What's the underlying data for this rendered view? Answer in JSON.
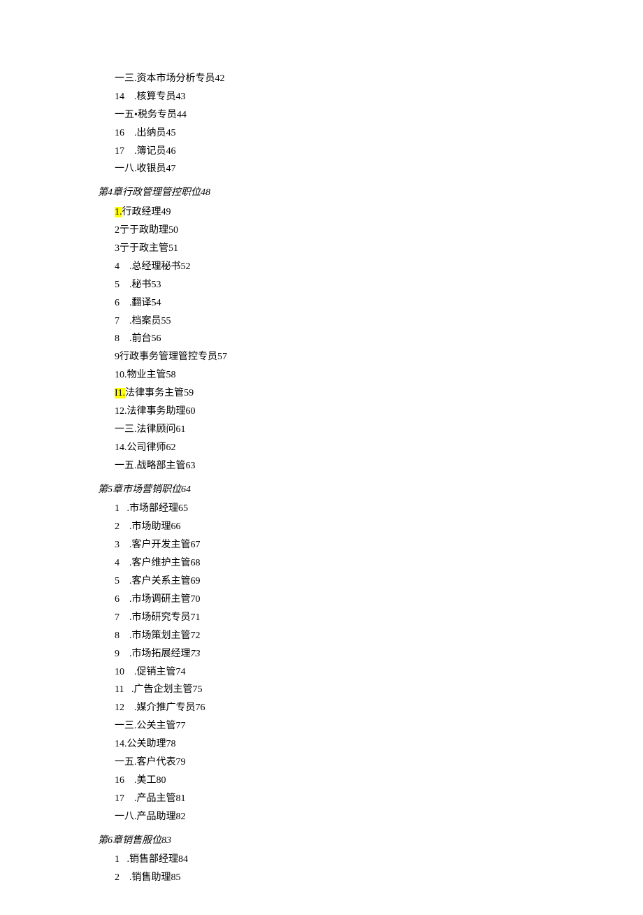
{
  "block1": [
    {
      "prefix": "一三.",
      "title": "资本市场分析专员",
      "page": "42"
    },
    {
      "prefix": "14    .",
      "title": "核算专员",
      "page": "43"
    },
    {
      "prefix": "一五•",
      "title": "税务专员",
      "page": "44"
    },
    {
      "prefix": "16    .",
      "title": "出纳员",
      "page": "45"
    },
    {
      "prefix": "17    .",
      "title": "簿记员",
      "page": "46"
    },
    {
      "prefix": "一八.",
      "title": "收银员",
      "page": "47"
    }
  ],
  "chapter4": {
    "label": "第",
    "num": "4",
    "rest": "章行政管理管控职位",
    "page": "48"
  },
  "block4": [
    {
      "prefix_hl": "1.",
      "suffix": "行政经理49"
    },
    {
      "line": "2亍于政助理50"
    },
    {
      "line": "3亍于政主管51"
    },
    {
      "line": "4    .总经理秘书52"
    },
    {
      "line": "5    .秘书53"
    },
    {
      "line": "6    .翻译54"
    },
    {
      "line": "7    .档案员55"
    },
    {
      "line": "8    .前台56"
    },
    {
      "line": "9行政事务管理管控专员57"
    },
    {
      "line": "10.物业主管58"
    },
    {
      "prefix_hl": "I1.",
      "suffix": "法律事务主管59"
    },
    {
      "line": "12.法律事务助理60"
    },
    {
      "line": "一三.法律顾问61"
    },
    {
      "line": "14.公司律师62"
    },
    {
      "line": "一五.战略部主管63"
    }
  ],
  "chapter5": {
    "label": "第",
    "num": "5",
    "rest": "章市场营销职位",
    "page": "64"
  },
  "block5": [
    {
      "line": "1   .市场部经理65"
    },
    {
      "line": "2    .市场助理66"
    },
    {
      "line": "3    .客户开发主管67"
    },
    {
      "line": "4    .客户维护主管68"
    },
    {
      "line": "5    .客户关系主管69"
    },
    {
      "line": "6    .市场调研主管70"
    },
    {
      "line": "7    .市场研究专员71"
    },
    {
      "line": "8    .市场策划主管72"
    },
    {
      "pre": "9    .市场拓展经理",
      "page_italic": "73"
    },
    {
      "line": "10    .促销主管74"
    },
    {
      "line": "11   .广告企划主管75"
    },
    {
      "line": "12    .媒介推广专员76"
    },
    {
      "line": "一三.公关主管77"
    },
    {
      "line": "14.公关助理78"
    },
    {
      "line": "一五.客户代表79"
    },
    {
      "line": "16    .美工80"
    },
    {
      "line": "17    .产品主管81"
    },
    {
      "line": "一八.产品助理82"
    }
  ],
  "chapter6": {
    "label": "第",
    "num": "6",
    "rest": "章销售服位",
    "page": "83"
  },
  "block6": [
    {
      "line": "1   .销售部经理84"
    },
    {
      "line": "2    .销售助理85"
    }
  ]
}
